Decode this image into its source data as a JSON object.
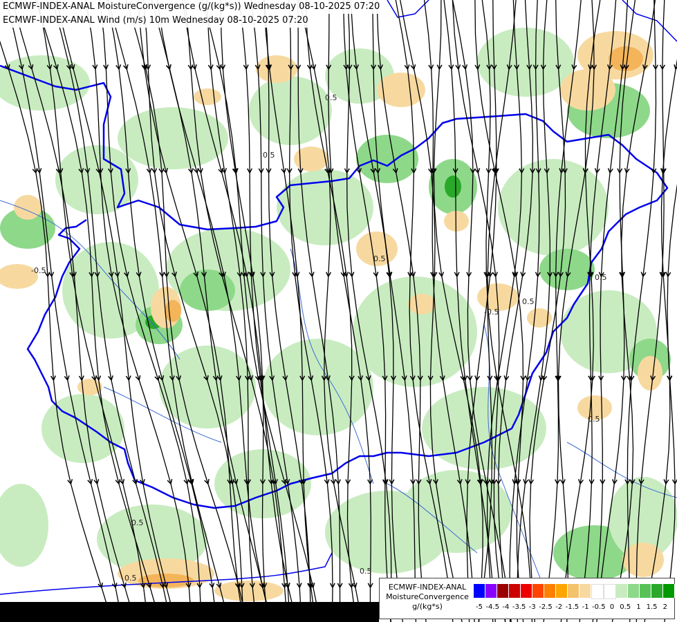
{
  "title_line_1": "ECMWF-INDEX-ANAL MoistureConvergence (g/(kg*s)) Wednesday 08-10-2025 07:20",
  "title_line_2": "ECMWF-INDEX-ANAL Wind (m/s) 10m Wednesday 08-10-2025 07:20",
  "legend": {
    "line1": "ECMWF-INDEX-ANAL",
    "line2": "MoistureConvergence",
    "line3": "g/(kg*s)",
    "swatch_colors": [
      "#0000ff",
      "#8a00ff",
      "#9b0000",
      "#cc0000",
      "#ee0000",
      "#ff4400",
      "#ff7f00",
      "#ffa500",
      "#f4c26b",
      "#f7d9a0",
      "#ffffff",
      "#ffffff",
      "#c8ecc0",
      "#8ed88a",
      "#58c258",
      "#2aa82a",
      "#009900"
    ],
    "ticks": [
      "-5",
      "-4.5",
      "-4",
      "-3.5",
      "-3",
      "-2.5",
      "-2",
      "-1.5",
      "-1",
      "-0.5",
      "0",
      "0.5",
      "1",
      "1.5",
      "2"
    ]
  },
  "map": {
    "contour_label": "0.5",
    "contour_label_negative": "-0.5",
    "colors": {
      "light_green": "#c8ecc0",
      "mid_green": "#8ed88a",
      "dark_green": "#2aa82a",
      "light_orange": "#f7d9a0",
      "orange": "#f4b45a",
      "border_blue": "#0000ee",
      "river_blue": "#3d6bd6",
      "streamline": "#000000"
    }
  }
}
